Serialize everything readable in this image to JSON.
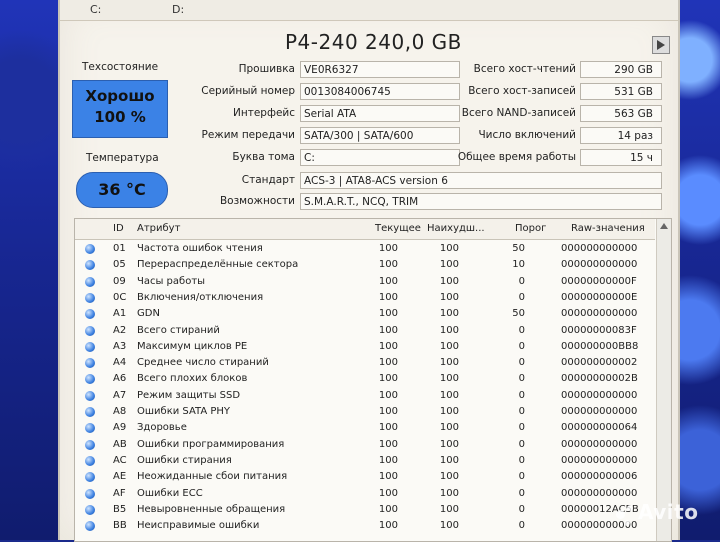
{
  "drives": [
    {
      "label": "C:"
    },
    {
      "label": "D:"
    }
  ],
  "title": "P4-240 240,0 GB",
  "health": {
    "label": "Техсостояние",
    "status": "Хорошо",
    "percent": "100 %"
  },
  "temperature": {
    "label": "Температура",
    "value": "36 °C"
  },
  "info_left": [
    {
      "label": "Прошивка",
      "value": "VE0R6327"
    },
    {
      "label": "Серийный номер",
      "value": "0013084006745"
    },
    {
      "label": "Интерфейс",
      "value": "Serial ATA"
    },
    {
      "label": "Режим передачи",
      "value": "SATA/300 | SATA/600"
    },
    {
      "label": "Буква тома",
      "value": "C:"
    }
  ],
  "info_right": [
    {
      "label": "Всего хост-чтений",
      "value": "290 GB"
    },
    {
      "label": "Всего хост-записей",
      "value": "531 GB"
    },
    {
      "label": "Всего NAND-записей",
      "value": "563 GB"
    },
    {
      "label": "Число включений",
      "value": "14 раз"
    },
    {
      "label": "Общее время работы",
      "value": "15 ч"
    }
  ],
  "standard": {
    "label": "Стандарт",
    "value": "ACS-3 | ATA8-ACS version 6"
  },
  "features": {
    "label": "Возможности",
    "value": "S.M.A.R.T., NCQ, TRIM"
  },
  "table": {
    "headers": {
      "id": "ID",
      "attr": "Атрибут",
      "current": "Текущее",
      "worst": "Наихудш...",
      "threshold": "Порог",
      "raw": "Raw-значения"
    },
    "rows": [
      {
        "id": "01",
        "attr": "Частота ошибок чтения",
        "current": "100",
        "worst": "100",
        "threshold": "50",
        "raw": "000000000000"
      },
      {
        "id": "05",
        "attr": "Перераспределённые сектора",
        "current": "100",
        "worst": "100",
        "threshold": "10",
        "raw": "000000000000"
      },
      {
        "id": "09",
        "attr": "Часы работы",
        "current": "100",
        "worst": "100",
        "threshold": "0",
        "raw": "00000000000F"
      },
      {
        "id": "0C",
        "attr": "Включения/отключения",
        "current": "100",
        "worst": "100",
        "threshold": "0",
        "raw": "00000000000E"
      },
      {
        "id": "A1",
        "attr": "GDN",
        "current": "100",
        "worst": "100",
        "threshold": "50",
        "raw": "000000000000"
      },
      {
        "id": "A2",
        "attr": "Всего стираний",
        "current": "100",
        "worst": "100",
        "threshold": "0",
        "raw": "00000000083F"
      },
      {
        "id": "A3",
        "attr": "Максимум циклов PE",
        "current": "100",
        "worst": "100",
        "threshold": "0",
        "raw": "000000000BB8"
      },
      {
        "id": "A4",
        "attr": "Среднее число стираний",
        "current": "100",
        "worst": "100",
        "threshold": "0",
        "raw": "000000000002"
      },
      {
        "id": "A6",
        "attr": "Всего плохих блоков",
        "current": "100",
        "worst": "100",
        "threshold": "0",
        "raw": "00000000002B"
      },
      {
        "id": "A7",
        "attr": "Режим защиты SSD",
        "current": "100",
        "worst": "100",
        "threshold": "0",
        "raw": "000000000000"
      },
      {
        "id": "A8",
        "attr": "Ошибки SATA PHY",
        "current": "100",
        "worst": "100",
        "threshold": "0",
        "raw": "000000000000"
      },
      {
        "id": "A9",
        "attr": "Здоровье",
        "current": "100",
        "worst": "100",
        "threshold": "0",
        "raw": "000000000064"
      },
      {
        "id": "AB",
        "attr": "Ошибки программирования",
        "current": "100",
        "worst": "100",
        "threshold": "0",
        "raw": "000000000000"
      },
      {
        "id": "AC",
        "attr": "Ошибки стирания",
        "current": "100",
        "worst": "100",
        "threshold": "0",
        "raw": "000000000000"
      },
      {
        "id": "AE",
        "attr": "Неожиданные сбои питания",
        "current": "100",
        "worst": "100",
        "threshold": "0",
        "raw": "000000000006"
      },
      {
        "id": "AF",
        "attr": "Ошибки ECC",
        "current": "100",
        "worst": "100",
        "threshold": "0",
        "raw": "000000000000"
      },
      {
        "id": "B5",
        "attr": "Невыровненные обращения",
        "current": "100",
        "worst": "100",
        "threshold": "0",
        "raw": "00000012AC5B"
      },
      {
        "id": "BB",
        "attr": "Неисправимые ошибки",
        "current": "100",
        "worst": "100",
        "threshold": "0",
        "raw": "000000000000"
      }
    ]
  },
  "watermark": "Avito",
  "colors": {
    "health_good": "#3b82e6",
    "window_bg": "#f6f3ec"
  }
}
